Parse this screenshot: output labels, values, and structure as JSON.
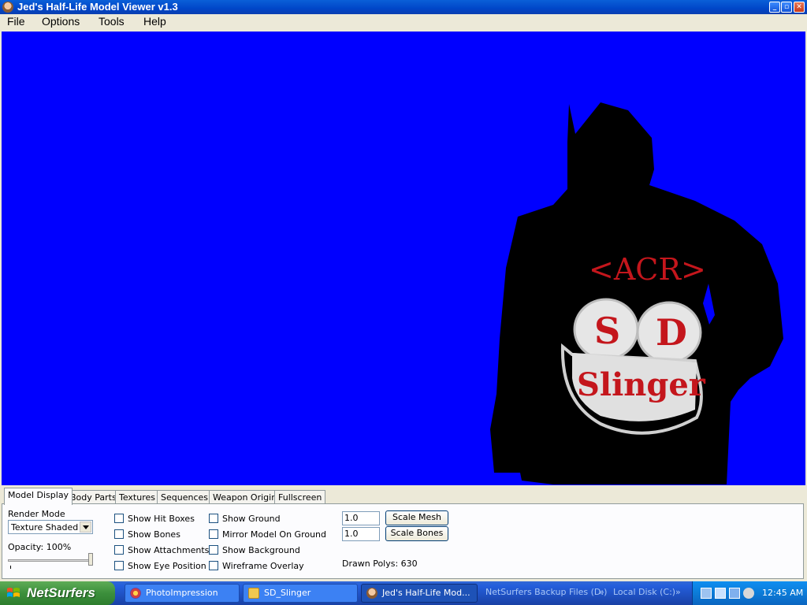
{
  "window": {
    "title": "Jed's Half-Life Model Viewer v1.3"
  },
  "menu": [
    "File",
    "Options",
    "Tools",
    "Help"
  ],
  "tabs": [
    "Model Display",
    "Body Parts",
    "Textures",
    "Sequences",
    "Weapon Origin",
    "Fullscreen"
  ],
  "active_tab": "Model Display",
  "model_display": {
    "render_mode_label": "Render Mode",
    "render_mode_value": "Texture Shaded",
    "opacity_label": "Opacity: 100%",
    "opacity_value": 1.0,
    "checkboxes_col1": [
      "Show Hit Boxes",
      "Show Bones",
      "Show Attachments",
      "Show Eye Position"
    ],
    "checkboxes_col2": [
      "Show Ground",
      "Mirror Model On Ground",
      "Show Background",
      "Wireframe Overlay"
    ],
    "scale_mesh_value": "1.0",
    "scale_mesh_button": "Scale Mesh",
    "scale_bones_value": "1.0",
    "scale_bones_button": "Scale Bones",
    "drawn_polys": "Drawn Polys: 630"
  },
  "viewport": {
    "background_color": "#0000ff",
    "model_logo_text": [
      "<ACR>",
      "S",
      "D",
      "Slinger"
    ]
  },
  "taskbar": {
    "start_label": "NetSurfers",
    "tasks": [
      "PhotoImpression",
      "SD_Slinger",
      "Jed's Half-Life Mod..."
    ],
    "active_task": "Jed's Half-Life Mod...",
    "quick_links": [
      "NetSurfers Backup Files (D:)",
      "Local Disk (C:)"
    ],
    "clock": "12:45 AM"
  }
}
